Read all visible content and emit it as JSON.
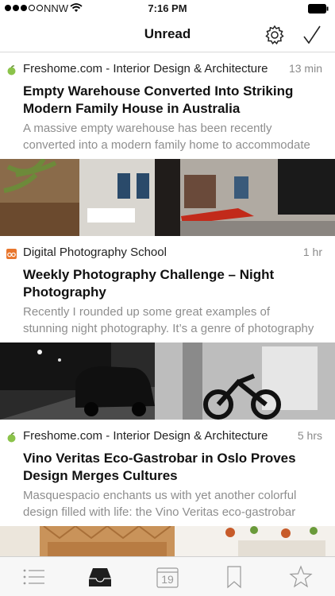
{
  "status_bar": {
    "carrier": "NNW",
    "time": "7:16 PM"
  },
  "nav": {
    "title": "Unread"
  },
  "articles": [
    {
      "source": "Freshome.com - Interior Design & Architecture",
      "time": "13 min",
      "title": "Empty Warehouse Converted Into Striking Modern Family House in Australia",
      "excerpt_lines": [
        "A massive empty warehouse has been recently",
        "converted into a modern family home to accommodate"
      ],
      "favicon": "green-apple-icon"
    },
    {
      "source": "Digital Photography School",
      "time": "1 hr",
      "title": "Weekly Photography Challenge – Night Photography",
      "excerpt_lines": [
        "Recently I rounded up some great examples of",
        "stunning night photography. It’s a genre of photography"
      ],
      "favicon": "orange-camera-icon"
    },
    {
      "source": "Freshome.com - Interior Design & Architecture",
      "time": "5 hrs",
      "title": "Vino Veritas Eco-Gastrobar in Oslo Proves Design Merges Cultures",
      "excerpt_lines": [
        "Masquespacio enchants us with yet another colorful",
        "design filled with life: the Vino Veritas eco-gastrobar"
      ],
      "favicon": "green-apple-icon"
    }
  ],
  "tab_bar": {
    "calendar_day": "19",
    "tabs": [
      "list-icon",
      "inbox-icon",
      "calendar-icon",
      "bookmark-icon",
      "star-icon"
    ],
    "active_tab": "inbox-icon"
  },
  "colors": {
    "accent": "#1a1a1a",
    "secondary_text": "#8e8e8e",
    "freshome_green": "#8bc34a",
    "dps_orange": "#e8762d"
  }
}
